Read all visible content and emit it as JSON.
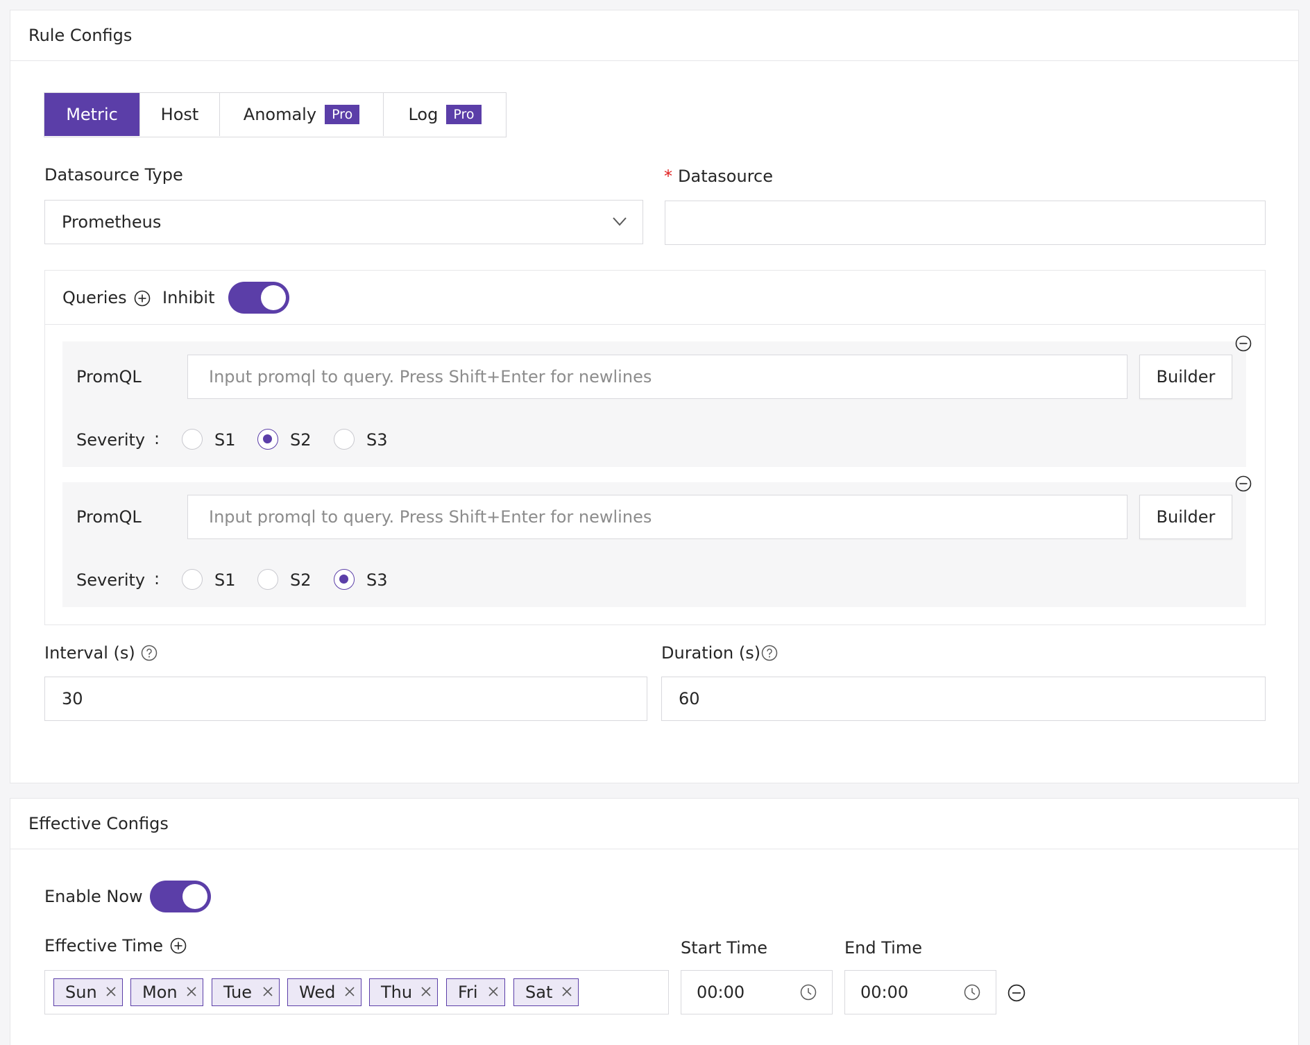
{
  "rule_configs": {
    "title": "Rule Configs",
    "tabs": [
      {
        "label": "Metric",
        "active": true,
        "pro": false
      },
      {
        "label": "Host",
        "active": false,
        "pro": false
      },
      {
        "label": "Anomaly",
        "active": false,
        "pro": true
      },
      {
        "label": "Log",
        "active": false,
        "pro": true
      }
    ],
    "pro_badge": "Pro",
    "datasource_type": {
      "label": "Datasource Type",
      "value": "Prometheus"
    },
    "datasource": {
      "label": "Datasource",
      "required_mark": "*",
      "value": ""
    },
    "queries": {
      "label": "Queries",
      "inhibit_label": "Inhibit",
      "inhibit_on": true,
      "items": [
        {
          "promql_label": "PromQL",
          "placeholder": "Input promql to query. Press Shift+Enter for newlines",
          "builder_label": "Builder",
          "severity_label": "Severity",
          "severity_colon": ":",
          "options": [
            "S1",
            "S2",
            "S3"
          ],
          "selected": "S2"
        },
        {
          "promql_label": "PromQL",
          "placeholder": "Input promql to query. Press Shift+Enter for newlines",
          "builder_label": "Builder",
          "severity_label": "Severity",
          "severity_colon": ":",
          "options": [
            "S1",
            "S2",
            "S3"
          ],
          "selected": "S3"
        }
      ]
    },
    "interval": {
      "label": "Interval (s)",
      "value": "30"
    },
    "duration": {
      "label": "Duration (s)",
      "value": "60"
    }
  },
  "effective_configs": {
    "title": "Effective Configs",
    "enable_now": {
      "label": "Enable Now",
      "on": true
    },
    "effective_time_label": "Effective Time",
    "days": [
      "Sun",
      "Mon",
      "Tue",
      "Wed",
      "Thu",
      "Fri",
      "Sat"
    ],
    "start_time": {
      "label": "Start Time",
      "value": "00:00"
    },
    "end_time": {
      "label": "End Time",
      "value": "00:00"
    }
  },
  "colors": {
    "accent": "#5b3ea8",
    "required": "#e02020",
    "border": "#d9d9dd",
    "query_bg": "#f6f6f7"
  }
}
